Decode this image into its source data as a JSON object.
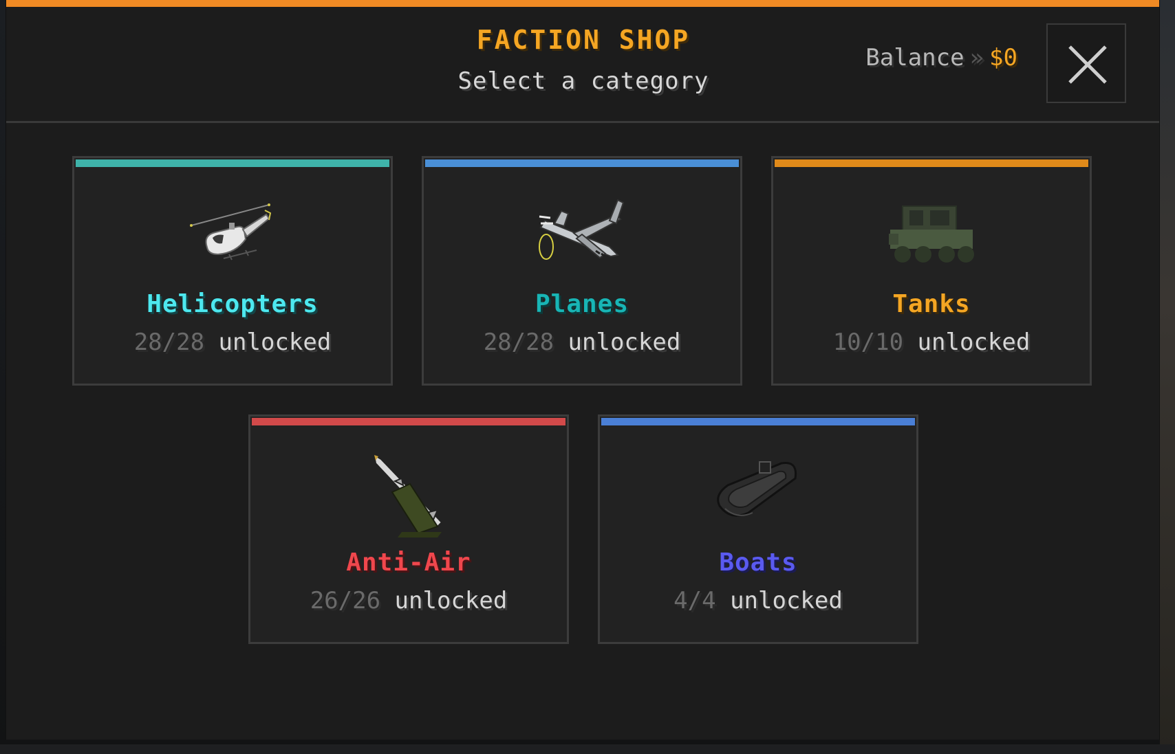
{
  "header": {
    "title": "FACTION SHOP",
    "subtitle": "Select a category",
    "balance_label": "Balance",
    "balance_separator": "»",
    "balance_amount": "$0",
    "accent_color": "#f08a24"
  },
  "categories": [
    {
      "name": "Helicopters",
      "unlocked": "28/28",
      "suffix": "unlocked",
      "color": "#4de8ef",
      "bar_color": "#3fb3aa",
      "icon": "helicopter-icon"
    },
    {
      "name": "Planes",
      "unlocked": "28/28",
      "suffix": "unlocked",
      "color": "#18b5b5",
      "bar_color": "#4a8fd6",
      "icon": "plane-icon"
    },
    {
      "name": "Tanks",
      "unlocked": "10/10",
      "suffix": "unlocked",
      "color": "#f5a623",
      "bar_color": "#e08a1a",
      "icon": "tank-icon"
    },
    {
      "name": "Anti-Air",
      "unlocked": "26/26",
      "suffix": "unlocked",
      "color": "#f0474d",
      "bar_color": "#d24a4a",
      "icon": "anti-air-missile-icon"
    },
    {
      "name": "Boats",
      "unlocked": "4/4",
      "suffix": "unlocked",
      "color": "#5a5af0",
      "bar_color": "#4a7fd6",
      "icon": "boat-icon"
    }
  ]
}
